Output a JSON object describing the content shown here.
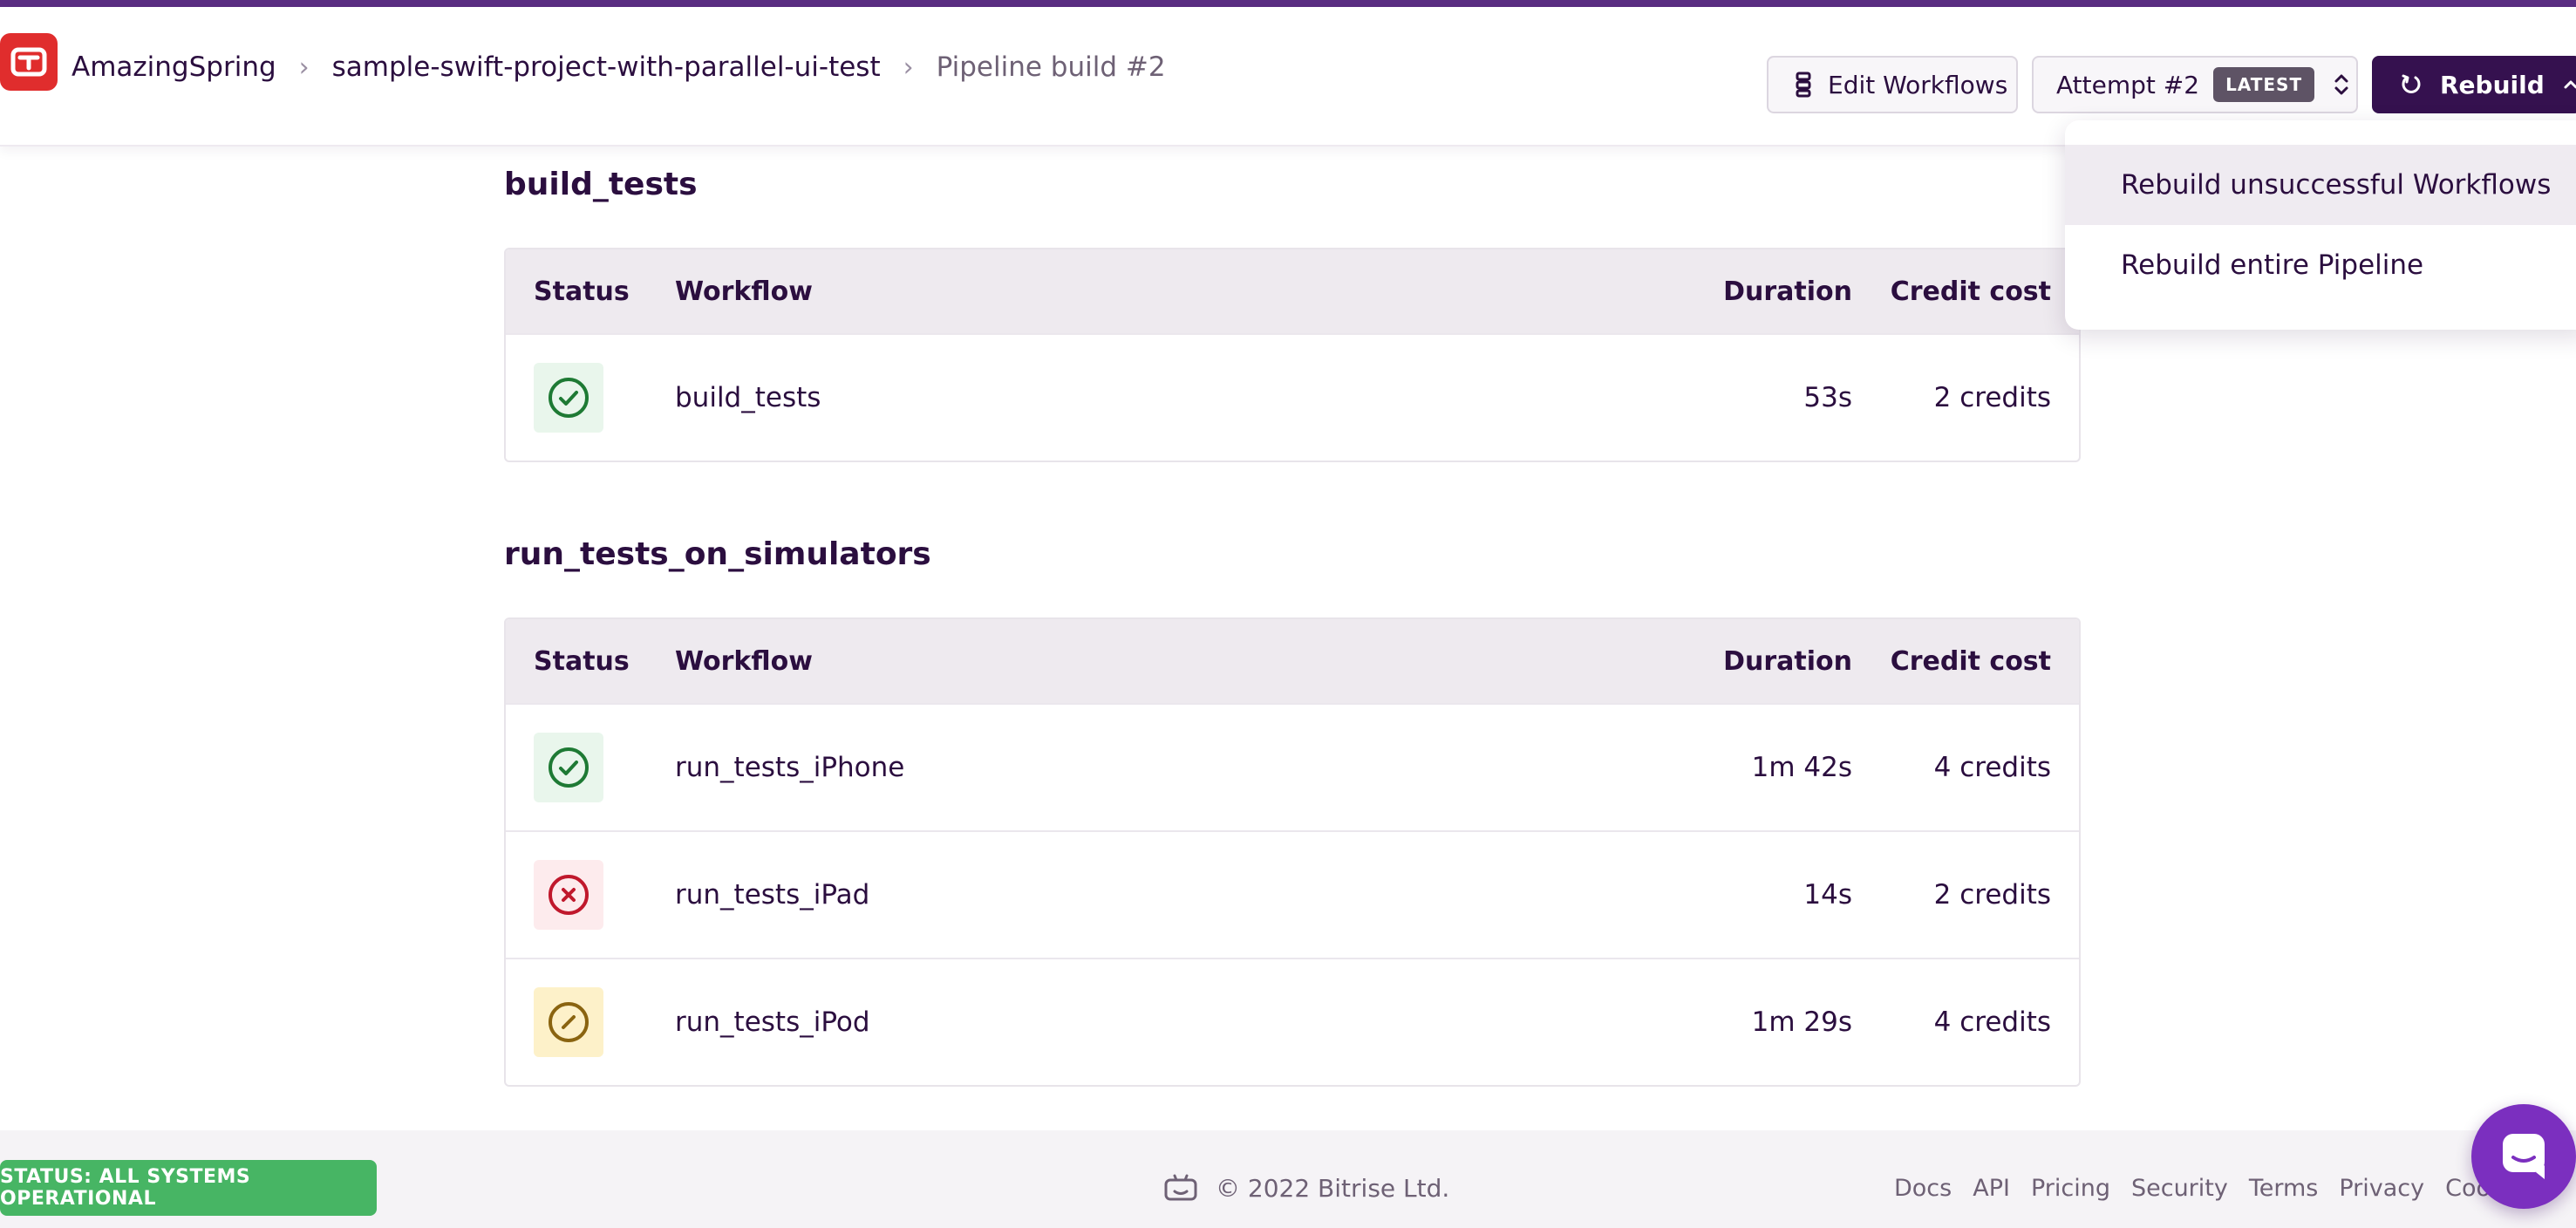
{
  "header": {
    "breadcrumbs": [
      {
        "label": "AmazingSpring"
      },
      {
        "label": "sample-swift-project-with-parallel-ui-test"
      },
      {
        "label": "Pipeline build #2"
      }
    ],
    "edit_workflows_label": "Edit Workflows",
    "attempt_label": "Attempt #2",
    "latest_badge": "LATEST",
    "rebuild_label": "Rebuild"
  },
  "rebuild_menu": {
    "items": [
      {
        "label": "Rebuild unsuccessful Workflows",
        "highlighted": true
      },
      {
        "label": "Rebuild entire Pipeline",
        "highlighted": false
      }
    ]
  },
  "table_headers": {
    "status": "Status",
    "workflow": "Workflow",
    "duration": "Duration",
    "credit_cost": "Credit cost"
  },
  "stages": [
    {
      "title": "build_tests",
      "rows": [
        {
          "status": "success",
          "workflow": "build_tests",
          "duration": "53s",
          "credits": "2 credits"
        }
      ]
    },
    {
      "title": "run_tests_on_simulators",
      "rows": [
        {
          "status": "success",
          "workflow": "run_tests_iPhone",
          "duration": "1m 42s",
          "credits": "4 credits"
        },
        {
          "status": "failed",
          "workflow": "run_tests_iPad",
          "duration": "14s",
          "credits": "2 credits"
        },
        {
          "status": "aborted",
          "workflow": "run_tests_iPod",
          "duration": "1m 29s",
          "credits": "4 credits"
        }
      ]
    }
  ],
  "status_colors": {
    "success": "#1e7a34",
    "failed": "#c0182c",
    "aborted": "#8a6410"
  },
  "footer": {
    "system_status": "STATUS: ALL SYSTEMS OPERATIONAL",
    "copyright": "© 2022 Bitrise Ltd.",
    "links": [
      "Docs",
      "API",
      "Pricing",
      "Security",
      "Terms",
      "Privacy",
      "Cookie"
    ]
  },
  "icons": {
    "logo": "bitrise-logo-icon",
    "edit": "workflow-icon",
    "attempt": "chevron-up-down-icon",
    "rebuild": "refresh-icon",
    "rebuild_caret": "chevron-up-icon",
    "success": "check-circle-icon",
    "failed": "x-circle-icon",
    "aborted": "slash-circle-icon",
    "footer": "bitbot-icon",
    "chat": "chat-icon"
  }
}
